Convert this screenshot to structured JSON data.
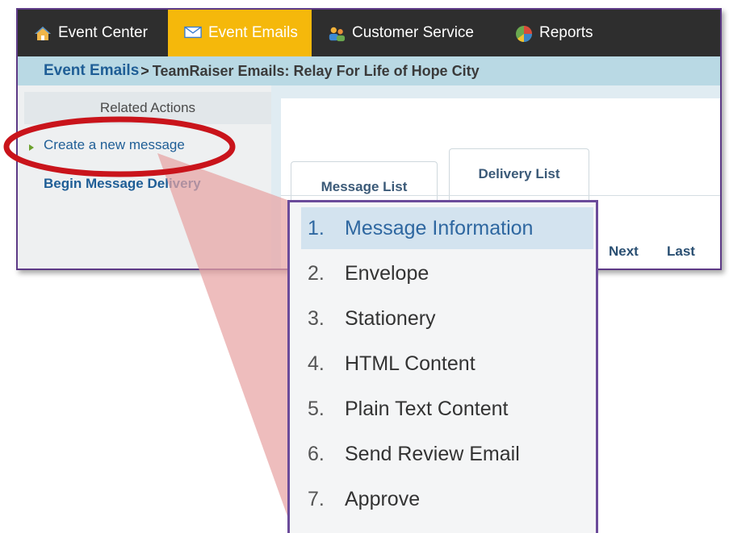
{
  "topnav": {
    "items": [
      {
        "label": "Event Center",
        "icon": "house-icon"
      },
      {
        "label": "Event Emails",
        "icon": "envelope-icon",
        "active": true
      },
      {
        "label": "Customer Service",
        "icon": "people-icon"
      },
      {
        "label": "Reports",
        "icon": "pie-chart-icon"
      }
    ]
  },
  "breadcrumb": {
    "link": "Event Emails",
    "separator": ">",
    "current": "TeamRaiser Emails:  Relay For Life of Hope City"
  },
  "sidebar": {
    "heading": "Related Actions",
    "actions": [
      "Create a new message",
      "Begin Message Delivery"
    ]
  },
  "content": {
    "tabs": [
      "Message List",
      "Delivery List"
    ],
    "pager": {
      "next": "Next",
      "last": "Last"
    }
  },
  "steps": {
    "items": [
      {
        "num": "1.",
        "label": "Message Information"
      },
      {
        "num": "2.",
        "label": "Envelope"
      },
      {
        "num": "3.",
        "label": "Stationery"
      },
      {
        "num": "4.",
        "label": "HTML Content"
      },
      {
        "num": "5.",
        "label": "Plain Text Content"
      },
      {
        "num": "6.",
        "label": "Send Review Email"
      },
      {
        "num": "7.",
        "label": "Approve"
      }
    ]
  },
  "colors": {
    "nav_bg": "#2e2e2e",
    "nav_active": "#f5b80b",
    "breadcrumb_bg": "#b9d9e4",
    "link": "#1f5e96",
    "callout_ring": "#c9141b",
    "callout_wedge": "#e8a3a3",
    "step_border": "#6b4b9a",
    "step_active_bg": "#d3e3ef"
  }
}
